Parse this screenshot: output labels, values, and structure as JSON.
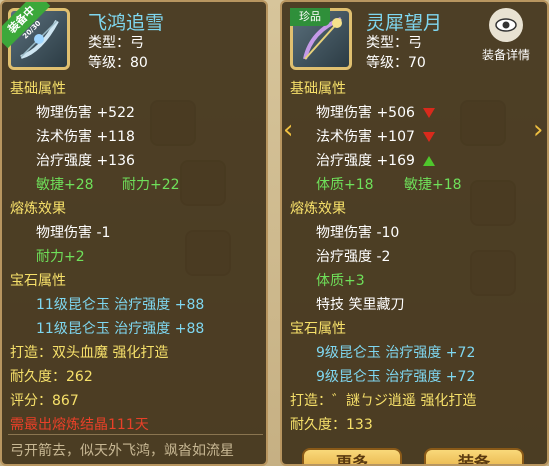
{
  "left": {
    "status_badge": "装备中",
    "status_sub": "20/30",
    "name": "飞鸿追雪",
    "type": "类型：弓",
    "level": "等级：80",
    "basic_header": "基础属性",
    "basic_stats": [
      {
        "label": "物理伤害",
        "value": "+522"
      },
      {
        "label": "法术伤害",
        "value": "+118"
      },
      {
        "label": "治疗强度",
        "value": "+136"
      }
    ],
    "basic_green": [
      {
        "label": "敏捷+28"
      },
      {
        "label": "耐力+22"
      }
    ],
    "refine_header": "熔炼效果",
    "refine_stats": [
      {
        "label": "物理伤害",
        "value": "-1"
      }
    ],
    "refine_green": "耐力+2",
    "gem_header": "宝石属性",
    "gems": [
      {
        "text": "11级昆仑玉  治疗强度  +88"
      },
      {
        "text": "11级昆仑玉  治疗强度  +88"
      }
    ],
    "forge": "打造：双头血魔   强化打造",
    "durability": "耐久度：262",
    "score": "评分：867",
    "warning": "需最出熔炼结晶111天",
    "description": "弓开箭去，似天外飞鸿，飒沓如流星"
  },
  "right": {
    "rarity_badge": "珍品",
    "name": "灵犀望月",
    "type": "类型：弓",
    "level": "等级：70",
    "detail_label": "装备详情",
    "basic_header": "基础属性",
    "basic_stats": [
      {
        "label": "物理伤害",
        "value": "+506",
        "trend": "down"
      },
      {
        "label": "法术伤害",
        "value": "+107",
        "trend": "down"
      },
      {
        "label": "治疗强度",
        "value": "+169",
        "trend": "up"
      }
    ],
    "basic_green": [
      {
        "label": "体质+18"
      },
      {
        "label": "敏捷+18"
      }
    ],
    "refine_header": "熔炼效果",
    "refine_stats": [
      {
        "label": "物理伤害",
        "value": "-10"
      },
      {
        "label": "治疗强度",
        "value": "-2"
      }
    ],
    "refine_green": "体质+3",
    "special": "特技  笑里藏刀",
    "gem_header": "宝石属性",
    "gems": [
      {
        "text": "9级昆仑玉  治疗强度  +72"
      },
      {
        "text": "9级昆仑玉  治疗强度  +72"
      }
    ],
    "forge": "打造：゛謎ㄅジ逍遥   强化打造",
    "durability": "耐久度：133",
    "buttons": {
      "more": "更多",
      "equip": "装备"
    }
  },
  "nav": {
    "prev": "‹",
    "next": "›"
  }
}
